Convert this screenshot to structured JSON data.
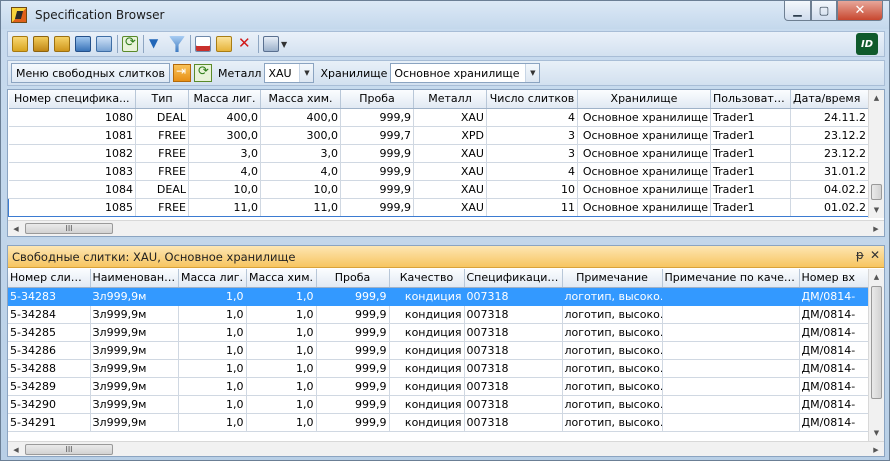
{
  "window": {
    "title": "Specification Browser"
  },
  "toolbar": {
    "icons": [
      "open-folder-icon",
      "folder-icon",
      "folder-open-icon",
      "network-icon",
      "grid-icon",
      "refresh-icon",
      "filter-icon",
      "clear-filter-icon",
      "edit-icon",
      "add-icon",
      "delete-icon",
      "print-icon"
    ],
    "logo_text": "ID"
  },
  "filterbar": {
    "menu_label": "Меню свободных слитков",
    "metal_label": "Металл",
    "metal_value": "XAU",
    "storage_label": "Хранилище",
    "storage_value": "Основное хранилище"
  },
  "specs": {
    "columns": [
      "Номер специфика...",
      "Тип",
      "Масса лиг.",
      "Масса хим.",
      "Проба",
      "Металл",
      "Число слитков",
      "Хранилище",
      "Пользователь",
      "Дата/время"
    ],
    "rows": [
      [
        "1080",
        "DEAL",
        "400,0",
        "400,0",
        "999,9",
        "XAU",
        "4",
        "Основное хранилище",
        "Trader1",
        "24.11.2"
      ],
      [
        "1081",
        "FREE",
        "300,0",
        "300,0",
        "999,7",
        "XPD",
        "3",
        "Основное хранилище",
        "Trader1",
        "23.12.2"
      ],
      [
        "1082",
        "FREE",
        "3,0",
        "3,0",
        "999,9",
        "XAU",
        "3",
        "Основное хранилище",
        "Trader1",
        "23.12.2"
      ],
      [
        "1083",
        "FREE",
        "4,0",
        "4,0",
        "999,9",
        "XAU",
        "4",
        "Основное хранилище",
        "Trader1",
        "31.01.2"
      ],
      [
        "1084",
        "DEAL",
        "10,0",
        "10,0",
        "999,9",
        "XAU",
        "10",
        "Основное хранилище",
        "Trader1",
        "04.02.2"
      ],
      [
        "1085",
        "FREE",
        "11,0",
        "11,0",
        "999,9",
        "XAU",
        "11",
        "Основное хранилище",
        "Trader1",
        "01.02.2"
      ]
    ],
    "hscroll_grip": "III"
  },
  "panel": {
    "title": "Свободные слитки: XAU, Основное хранилище",
    "pin": "ᵽ",
    "close": "✕"
  },
  "bars": {
    "columns": [
      "Номер слитка",
      "Наименование",
      "Масса лиг.",
      "Масса хим.",
      "Проба",
      "Качество",
      "Спецификация с...",
      "Примечание",
      "Примечание по качеству",
      "Номер вх"
    ],
    "rows": [
      [
        "5-34283",
        "Зл999,9м",
        "1,0",
        "1,0",
        "999,9",
        "кондиция",
        "007318",
        "логотип, высоко...",
        "",
        "ДМ/0814-"
      ],
      [
        "5-34284",
        "Зл999,9м",
        "1,0",
        "1,0",
        "999,9",
        "кондиция",
        "007318",
        "логотип, высоко...",
        "",
        "ДМ/0814-"
      ],
      [
        "5-34285",
        "Зл999,9м",
        "1,0",
        "1,0",
        "999,9",
        "кондиция",
        "007318",
        "логотип, высоко...",
        "",
        "ДМ/0814-"
      ],
      [
        "5-34286",
        "Зл999,9м",
        "1,0",
        "1,0",
        "999,9",
        "кондиция",
        "007318",
        "логотип, высоко...",
        "",
        "ДМ/0814-"
      ],
      [
        "5-34288",
        "Зл999,9м",
        "1,0",
        "1,0",
        "999,9",
        "кондиция",
        "007318",
        "логотип, высоко...",
        "",
        "ДМ/0814-"
      ],
      [
        "5-34289",
        "Зл999,9м",
        "1,0",
        "1,0",
        "999,9",
        "кондиция",
        "007318",
        "логотип, высоко...",
        "",
        "ДМ/0814-"
      ],
      [
        "5-34290",
        "Зл999,9м",
        "1,0",
        "1,0",
        "999,9",
        "кондиция",
        "007318",
        "логотип, высоко...",
        "",
        "ДМ/0814-"
      ],
      [
        "5-34291",
        "Зл999,9м",
        "1,0",
        "1,0",
        "999,9",
        "кондиция",
        "007318",
        "логотип, высоко...",
        "",
        "ДМ/0814-"
      ]
    ],
    "hscroll_grip": "III"
  }
}
